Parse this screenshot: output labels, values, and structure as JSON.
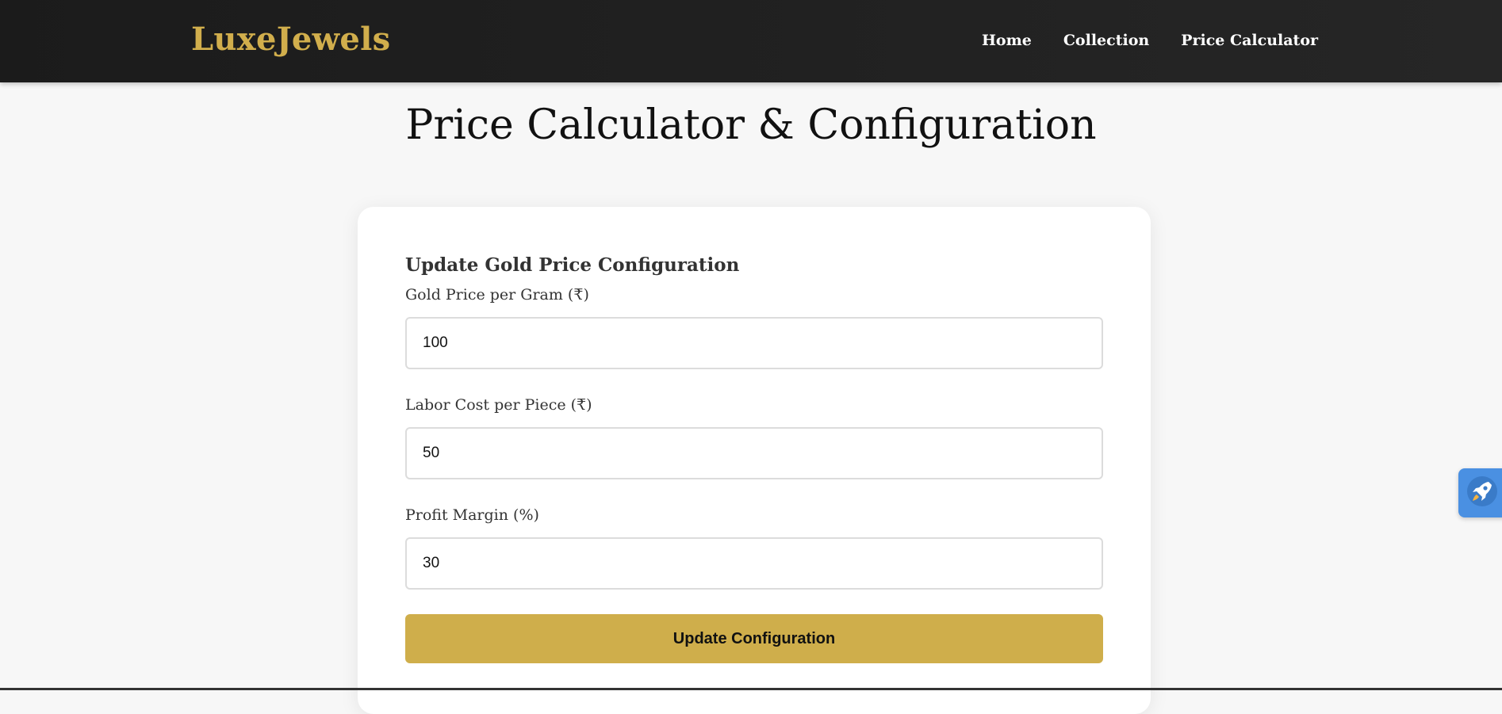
{
  "header": {
    "logo": "LuxeJewels",
    "nav": [
      "Home",
      "Collection",
      "Price Calculator"
    ]
  },
  "page_title": "Price Calculator & Configuration",
  "config_form": {
    "heading": "Update Gold Price Configuration",
    "fields": [
      {
        "label": "Gold Price per Gram (₹)",
        "value": "100"
      },
      {
        "label": "Labor Cost per Piece (₹)",
        "value": "50"
      },
      {
        "label": "Profit Margin (%)",
        "value": "30"
      }
    ],
    "submit_label": "Update Configuration"
  },
  "colors": {
    "accent_gold": "#cfae4b",
    "header_bg": "#1f1f1f",
    "page_bg": "#f7f7f7",
    "floating_button_bg": "#4a90e2"
  },
  "icons": {
    "floating_button": "rocket-icon"
  }
}
